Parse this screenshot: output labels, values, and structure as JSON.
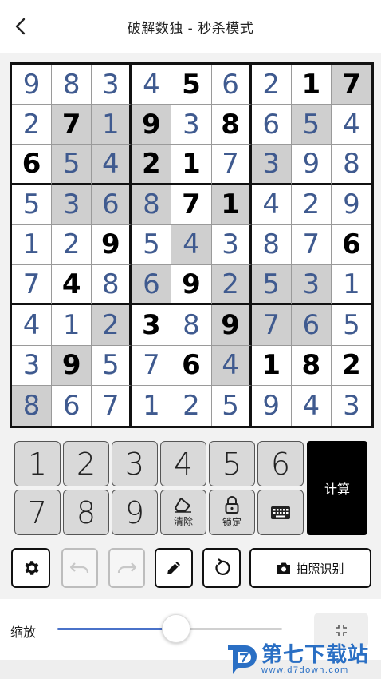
{
  "header": {
    "title": "破解数独 - 秒杀模式",
    "back_icon": "chevron-left-icon"
  },
  "board": {
    "cells": [
      [
        "9",
        "8",
        "3",
        "4",
        "5",
        "6",
        "2",
        "1",
        "7"
      ],
      [
        "2",
        "7",
        "1",
        "9",
        "3",
        "8",
        "6",
        "5",
        "4"
      ],
      [
        "6",
        "5",
        "4",
        "2",
        "1",
        "7",
        "3",
        "9",
        "8"
      ],
      [
        "5",
        "3",
        "6",
        "8",
        "7",
        "1",
        "4",
        "2",
        "9"
      ],
      [
        "1",
        "2",
        "9",
        "5",
        "4",
        "3",
        "8",
        "7",
        "6"
      ],
      [
        "7",
        "4",
        "8",
        "6",
        "9",
        "2",
        "5",
        "3",
        "1"
      ],
      [
        "4",
        "1",
        "2",
        "3",
        "8",
        "9",
        "7",
        "6",
        "5"
      ],
      [
        "3",
        "9",
        "5",
        "7",
        "6",
        "4",
        "1",
        "8",
        "2"
      ],
      [
        "8",
        "6",
        "7",
        "1",
        "2",
        "5",
        "9",
        "4",
        "3"
      ]
    ],
    "given": [
      [
        0,
        0,
        0,
        0,
        1,
        0,
        0,
        1,
        1
      ],
      [
        0,
        1,
        0,
        1,
        0,
        1,
        0,
        0,
        0
      ],
      [
        1,
        0,
        0,
        1,
        1,
        0,
        0,
        0,
        0
      ],
      [
        0,
        0,
        0,
        0,
        1,
        1,
        0,
        0,
        0
      ],
      [
        0,
        0,
        1,
        0,
        0,
        0,
        0,
        0,
        1
      ],
      [
        0,
        1,
        0,
        0,
        1,
        0,
        0,
        0,
        0
      ],
      [
        0,
        0,
        0,
        1,
        0,
        1,
        0,
        0,
        0
      ],
      [
        0,
        1,
        0,
        0,
        1,
        0,
        1,
        1,
        1
      ],
      [
        0,
        0,
        0,
        0,
        0,
        0,
        0,
        0,
        0
      ]
    ],
    "shaded": [
      [
        0,
        0,
        0,
        0,
        0,
        0,
        0,
        0,
        1
      ],
      [
        0,
        1,
        1,
        1,
        0,
        0,
        0,
        1,
        0
      ],
      [
        0,
        1,
        1,
        1,
        0,
        0,
        1,
        0,
        0
      ],
      [
        0,
        1,
        1,
        1,
        0,
        1,
        0,
        0,
        0
      ],
      [
        0,
        0,
        0,
        0,
        1,
        0,
        0,
        0,
        0
      ],
      [
        0,
        0,
        0,
        1,
        0,
        1,
        1,
        1,
        0
      ],
      [
        0,
        0,
        1,
        0,
        0,
        1,
        1,
        1,
        0
      ],
      [
        0,
        1,
        0,
        0,
        0,
        1,
        0,
        0,
        0
      ],
      [
        1,
        0,
        0,
        0,
        0,
        0,
        0,
        0,
        0
      ]
    ],
    "given_color": "#000000",
    "solved_color": "#3f5a8f",
    "shade_color": "#cfcfcf"
  },
  "keypad": {
    "digits": [
      "1",
      "2",
      "3",
      "4",
      "5",
      "6",
      "7",
      "8",
      "9"
    ],
    "clear_label": "清除",
    "lock_label": "锁定",
    "clear_icon": "eraser-icon",
    "lock_icon": "lock-icon",
    "keyboard_icon": "keyboard-icon",
    "calc_label": "计算"
  },
  "toolbar": {
    "settings_icon": "gear-icon",
    "undo_icon": "undo-icon",
    "redo_icon": "redo-icon",
    "pencil_icon": "pencil-icon",
    "reset_icon": "rotate-icon",
    "photo_icon": "camera-icon",
    "photo_label": "拍照识别"
  },
  "zoom": {
    "label": "缩放",
    "value": 0.53,
    "fit_icon": "compress-icon",
    "accent": "#4a72c9"
  },
  "watermark": {
    "title": "第七下载站",
    "url": "www.d7down.com",
    "color": "#2a6fc4"
  }
}
